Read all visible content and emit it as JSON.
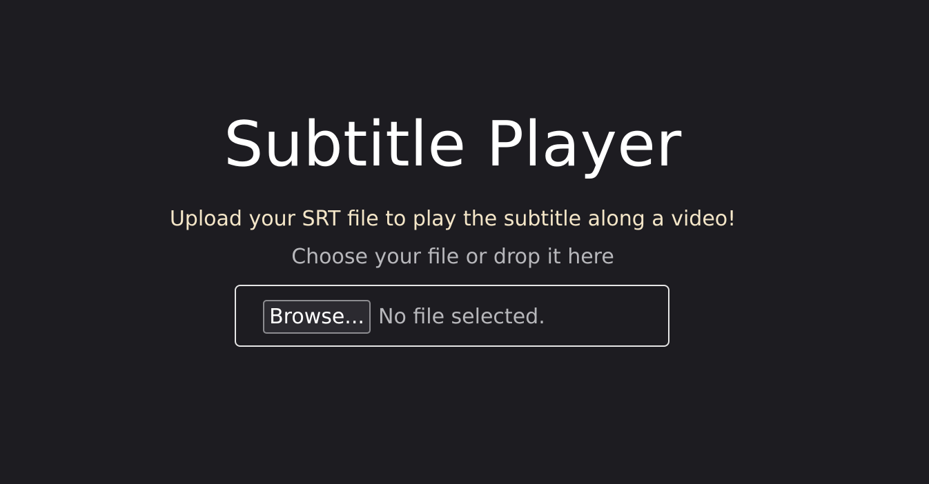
{
  "header": {
    "title": "Subtitle Player"
  },
  "intro": {
    "subtitle": "Upload your SRT file to play the subtitle along a video!",
    "hint": "Choose your file or drop it here"
  },
  "file_input": {
    "browse_label": "Browse...",
    "status": "No file selected."
  },
  "colors": {
    "background": "#1d1c21",
    "title": "#ffffff",
    "subtitle": "#f4e6c8",
    "hint": "#b7b7bb",
    "dropzone_border": "#e6e6e6"
  }
}
